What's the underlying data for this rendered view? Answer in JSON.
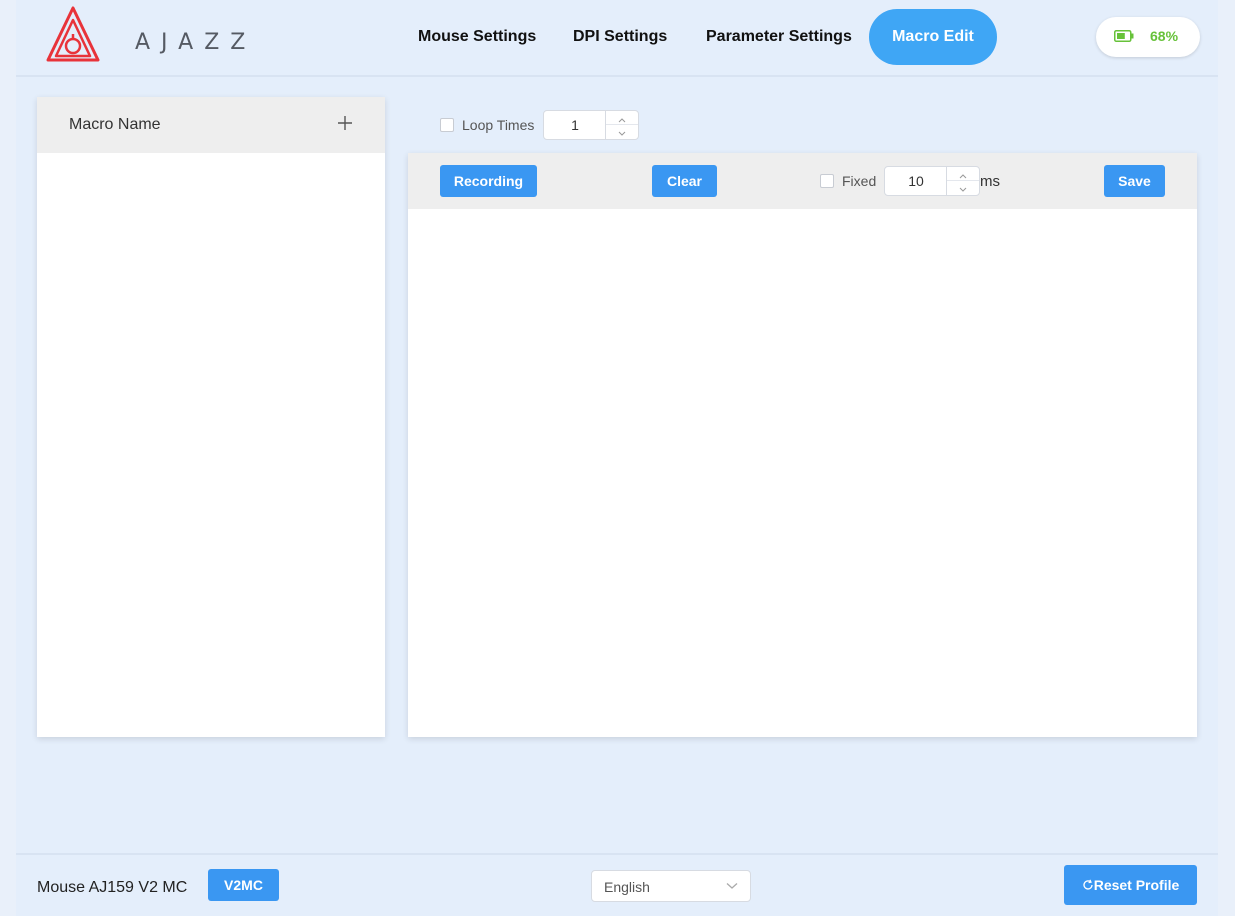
{
  "brand": {
    "name": "AJAZZ",
    "logo_color": "#e8333a"
  },
  "nav": {
    "items": [
      {
        "label": "Mouse Settings"
      },
      {
        "label": "DPI Settings"
      },
      {
        "label": "Parameter Settings"
      },
      {
        "label": "Macro Edit",
        "active": true
      }
    ]
  },
  "battery": {
    "percent_label": "68%",
    "level": 0.68,
    "color": "#67c23a"
  },
  "macro_list": {
    "header_label": "Macro Name",
    "add_icon": "plus-icon",
    "items": []
  },
  "loop": {
    "label": "Loop Times",
    "checked": false,
    "value": "1"
  },
  "toolbar": {
    "recording_label": "Recording",
    "clear_label": "Clear",
    "fixed_label": "Fixed",
    "fixed_checked": false,
    "fixed_value": "10",
    "unit_label": "ms",
    "save_label": "Save"
  },
  "footer": {
    "device_name": "Mouse AJ159 V2 MC",
    "version_badge": "V2MC",
    "language": "English",
    "reset_label": "Reset Profile",
    "reset_icon": "refresh-icon"
  },
  "colors": {
    "accent": "#3fa6f5",
    "button": "#3a97f2",
    "background": "#e4eefb"
  }
}
